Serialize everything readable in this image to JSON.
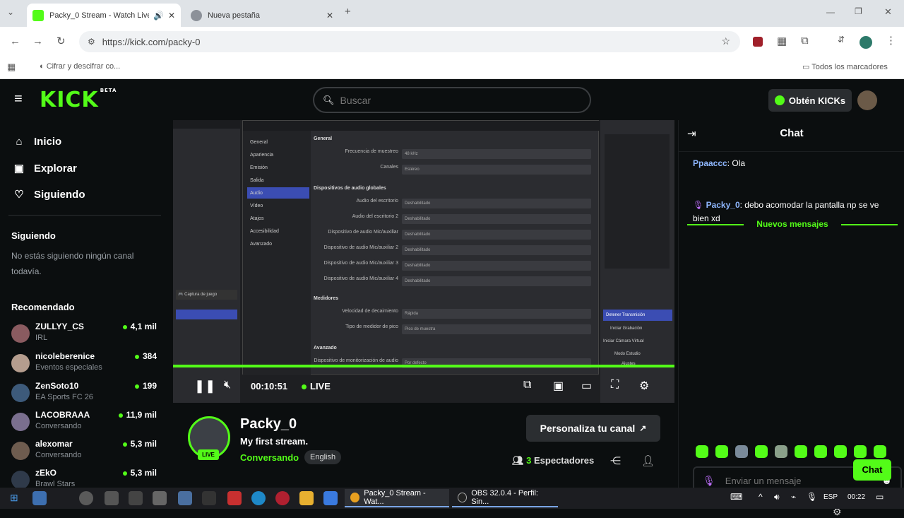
{
  "browser": {
    "tabs": [
      {
        "title": "Packy_0 Stream - Watch Live",
        "active": true
      },
      {
        "title": "Nueva pestaña",
        "active": false
      }
    ],
    "new_tab": "+",
    "url": "https://kick.com/packy-0",
    "bookmarks": {
      "left": "Cifrar y descifrar co...",
      "right": "Todos los marcadores"
    }
  },
  "kick": {
    "logo": "KICK",
    "logo_beta": "BETA",
    "search_placeholder": "Buscar",
    "obtain_kicks": "Obtén KICKs",
    "nav": [
      {
        "label": "Inicio",
        "icon": "home-icon"
      },
      {
        "label": "Explorar",
        "icon": "explore-icon"
      },
      {
        "label": "Siguiendo",
        "icon": "heart-icon"
      }
    ],
    "following_heading": "Siguiendo",
    "following_empty": "No estás siguiendo ningún canal todavía.",
    "recommended_heading": "Recomendado",
    "recommended": [
      {
        "name": "ZULLYY_CS",
        "category": "IRL",
        "viewers": "4,1 mil",
        "color": "#8a5b60"
      },
      {
        "name": "nicoleberenice",
        "category": "Eventos especiales",
        "viewers": "384",
        "color": "#b59d8e"
      },
      {
        "name": "ZenSoto10",
        "category": "EA Sports FC 26",
        "viewers": "199",
        "color": "#3d5a7a"
      },
      {
        "name": "LACOBRAAA",
        "category": "Conversando",
        "viewers": "11,9 mil",
        "color": "#7a6f8e"
      },
      {
        "name": "alexomar",
        "category": "Conversando",
        "viewers": "5,3 mil",
        "color": "#6e5c4f"
      },
      {
        "name": "zEkO",
        "category": "Brawl Stars",
        "viewers": "5,3 mil",
        "color": "#2f3a4a"
      }
    ]
  },
  "player": {
    "time": "00:10:51",
    "live": "LIVE",
    "obs": {
      "nav": [
        "General",
        "Apariencia",
        "Emisión",
        "Salida",
        "Audio",
        "Vídeo",
        "Atajos",
        "Accesibilidad",
        "Avanzado"
      ],
      "selected": "Audio",
      "sections": [
        "General",
        "Dispositivos de audio globales",
        "Medidores",
        "Avanzado"
      ],
      "rows": [
        {
          "label": "Frecuencia de muestreo",
          "value": "48 kHz"
        },
        {
          "label": "Canales",
          "value": "Estéreo"
        },
        {
          "label": "Audio del escritorio",
          "value": "Deshabilitado"
        },
        {
          "label": "Audio del escritorio 2",
          "value": "Deshabilitado"
        },
        {
          "label": "Dispositivo de audio Mic/auxiliar",
          "value": "Deshabilitado"
        },
        {
          "label": "Dispositivo de audio Mic/auxiliar 2",
          "value": "Deshabilitado"
        },
        {
          "label": "Dispositivo de audio Mic/auxiliar 3",
          "value": "Deshabilitado"
        },
        {
          "label": "Dispositivo de audio Mic/auxiliar 4",
          "value": "Deshabilitado"
        },
        {
          "label": "Velocidad de decaimiento",
          "value": "Rápida"
        },
        {
          "label": "Tipo de medidor de pico",
          "value": "Pico de muestra"
        },
        {
          "label": "Dispositivo de monitorización de audio",
          "value": "Por defecto"
        }
      ],
      "right_items": [
        "Detener Transmisión",
        "Iniciar Grabación",
        "Iniciar Cámara Virtual",
        "Modo Estudio",
        "Ajustes"
      ]
    }
  },
  "channel": {
    "name": "Packy_0",
    "title": "My first stream.",
    "category": "Conversando",
    "language": "English",
    "live_badge": "LIVE",
    "customize": "Personaliza tu canal",
    "viewers_count": "3",
    "viewers_label": "Espectadores"
  },
  "chat": {
    "title": "Chat",
    "messages": [
      {
        "user": "Ppaaccc",
        "text": "Ola"
      },
      {
        "user": "Packy_0",
        "text": "debo acomodar la pantalla np se ve bien xd"
      }
    ],
    "new_messages": "Nuevos mensajes",
    "input_placeholder": "Enviar un mensaje",
    "send": "Chat"
  },
  "taskbar": {
    "windows": [
      {
        "title": "Packy_0 Stream - Wat...",
        "active": true
      },
      {
        "title": "OBS 32.0.4 - Perfil: Sin...",
        "active": false
      }
    ],
    "lang": "ESP",
    "clock": "00:22"
  }
}
